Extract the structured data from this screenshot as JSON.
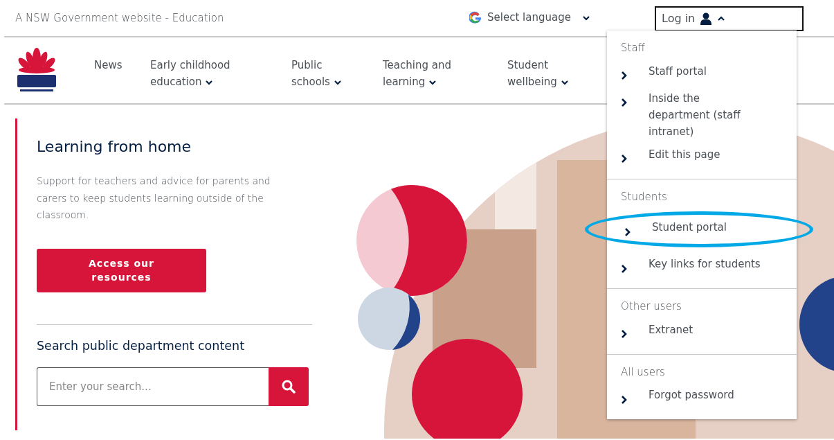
{
  "top_bar": {
    "site_label": "A NSW Government website - Education",
    "language": {
      "label": "Select language"
    },
    "login": {
      "label": "Log in",
      "expanded": true
    }
  },
  "nav": {
    "items": [
      {
        "label": "News",
        "dropdown": false
      },
      {
        "label": "Early childhood education",
        "dropdown": true
      },
      {
        "label": "Public schools",
        "dropdown": true
      },
      {
        "label": "Teaching and learning",
        "dropdown": true
      },
      {
        "label": "Student wellbeing",
        "dropdown": true
      }
    ]
  },
  "hero": {
    "title": "Learning from home",
    "text": "Support for teachers and advice for parents and carers to keep students learning outside of the classroom.",
    "button": "Access our resources",
    "search_heading": "Search public department content",
    "search": {
      "placeholder": "Enter your search..."
    }
  },
  "login_menu": {
    "sections": [
      {
        "heading": "Staff",
        "items": [
          {
            "label": "Staff portal",
            "highlighted": false
          },
          {
            "label": "Inside the department (staff intranet)",
            "highlighted": false
          },
          {
            "label": "Edit this page",
            "highlighted": false
          }
        ]
      },
      {
        "heading": "Students",
        "items": [
          {
            "label": "Student portal",
            "highlighted": true
          },
          {
            "label": "Key links for students",
            "highlighted": false
          }
        ]
      },
      {
        "heading": "Other users",
        "items": [
          {
            "label": "Extranet",
            "highlighted": false
          }
        ]
      },
      {
        "heading": "All users",
        "items": [
          {
            "label": "Forgot password",
            "highlighted": false
          }
        ]
      }
    ]
  }
}
